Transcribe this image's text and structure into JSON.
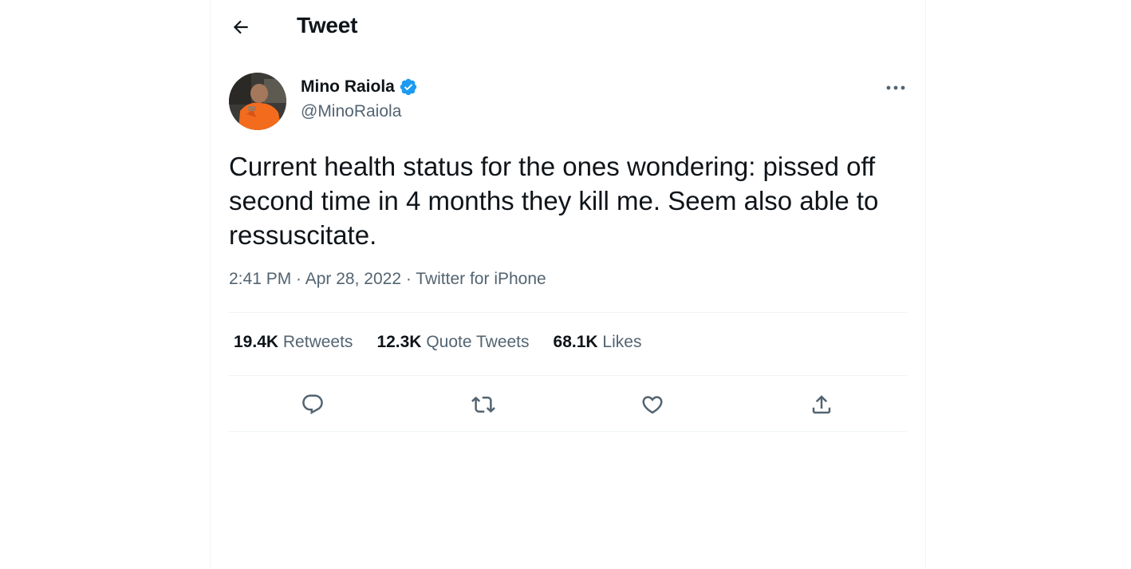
{
  "header": {
    "title": "Tweet",
    "back_icon": "arrow-left-icon"
  },
  "author": {
    "display_name": "Mino Raiola",
    "handle": "@MinoRaiola",
    "verified_icon": "verified-badge-icon",
    "verified_color": "#1d9bf0"
  },
  "tweet": {
    "text": "Current health status for the ones wondering: pissed off second time in 4 months they kill me. Seem also able to ressuscitate.",
    "time": "2:41 PM",
    "date": "Apr 28, 2022",
    "source": "Twitter for iPhone",
    "separator": " · "
  },
  "stats": {
    "retweets_count": "19.4K",
    "retweets_label": "Retweets",
    "quotes_count": "12.3K",
    "quotes_label": "Quote Tweets",
    "likes_count": "68.1K",
    "likes_label": "Likes"
  },
  "actions": {
    "reply_icon": "reply-icon",
    "retweet_icon": "retweet-icon",
    "like_icon": "heart-icon",
    "share_icon": "share-icon",
    "more_icon": "more-horizontal-icon"
  },
  "colors": {
    "text_primary": "#0f1419",
    "text_secondary": "#536471",
    "divider": "#eff3f4",
    "accent": "#1d9bf0"
  }
}
